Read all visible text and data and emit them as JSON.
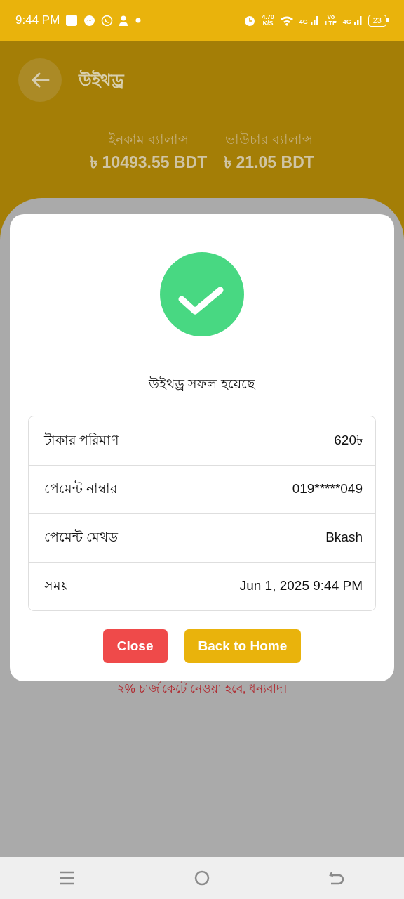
{
  "status_bar": {
    "time": "9:44 PM",
    "speed": "4.70",
    "speed_unit": "K/S",
    "sim_1": "4G",
    "volte": "Vo LTE",
    "sim_2": "4G",
    "battery": "23"
  },
  "header": {
    "title": "উইথড্র"
  },
  "balances": [
    {
      "label": "ইনকাম ব্যালান্স",
      "value": "৳ 10493.55 BDT"
    },
    {
      "label": "ভাউচার ব্যালান্স",
      "value": "৳ 21.05 BDT"
    }
  ],
  "note": "২% চার্জ কেটে নেওয়া হবে, ধন্যবাদ।",
  "dialog": {
    "title": "উইথড্র সফল হয়েছে",
    "rows": [
      {
        "label": "টাকার পরিমাণ",
        "value": "620৳"
      },
      {
        "label": "পেমেন্ট নাম্বার",
        "value": "019*****049"
      },
      {
        "label": "পেমেন্ট মেথড",
        "value": "Bkash"
      },
      {
        "label": "সময়",
        "value": "Jun 1, 2025 9:44 PM"
      }
    ],
    "buttons": [
      {
        "label": "Close",
        "kind": "danger"
      },
      {
        "label": "Back to Home",
        "kind": "primary"
      }
    ]
  }
}
